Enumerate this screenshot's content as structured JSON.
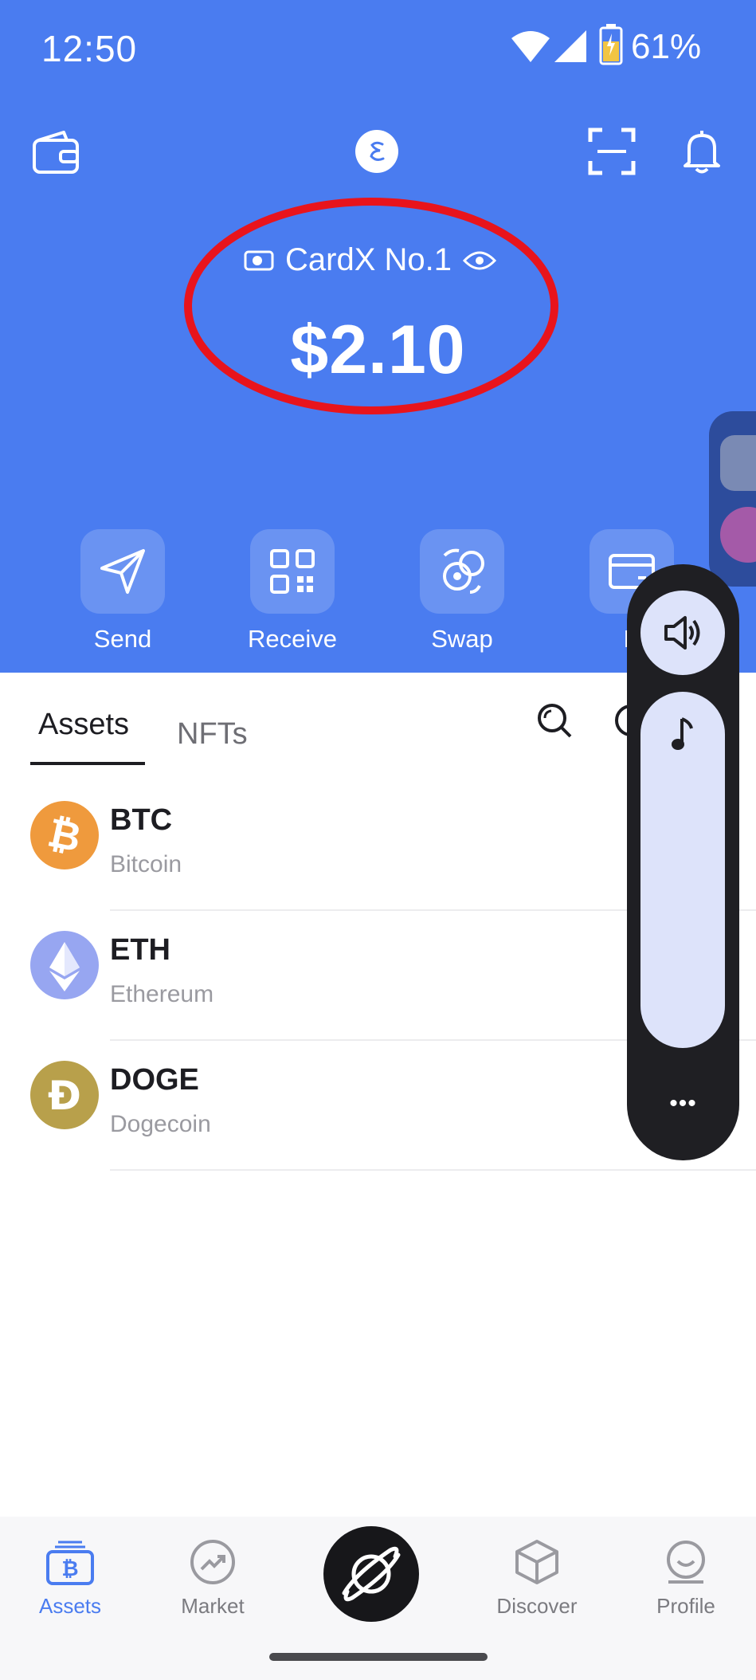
{
  "status_bar": {
    "time": "12:50",
    "battery": "61%"
  },
  "header": {
    "wallet_name": "CardX No.1",
    "balance": "$2.10"
  },
  "actions": [
    {
      "label": "Send",
      "icon": "send-icon"
    },
    {
      "label": "Receive",
      "icon": "qr-code-icon"
    },
    {
      "label": "Swap",
      "icon": "swap-icon"
    },
    {
      "label": "B",
      "icon": "card-icon"
    }
  ],
  "tabs": {
    "assets": "Assets",
    "nfts": "NFTs"
  },
  "assets": [
    {
      "symbol": "BTC",
      "name": "Bitcoin",
      "color": "#ef9a3d",
      "glyph": "₿"
    },
    {
      "symbol": "ETH",
      "name": "Ethereum",
      "color": "#97a6f1",
      "glyph": ""
    },
    {
      "symbol": "DOGE",
      "name": "Dogecoin",
      "color": "#b8a04b",
      "glyph": "Ð"
    }
  ],
  "volume_panel": {
    "more": "•••"
  },
  "bottom_nav": [
    {
      "label": "Assets",
      "active": true
    },
    {
      "label": "Market",
      "active": false
    },
    {
      "label": "Discover",
      "active": false
    },
    {
      "label": "Profile",
      "active": false
    }
  ],
  "colors": {
    "brand": "#4a7cf0",
    "highlight": "#e8141c"
  }
}
